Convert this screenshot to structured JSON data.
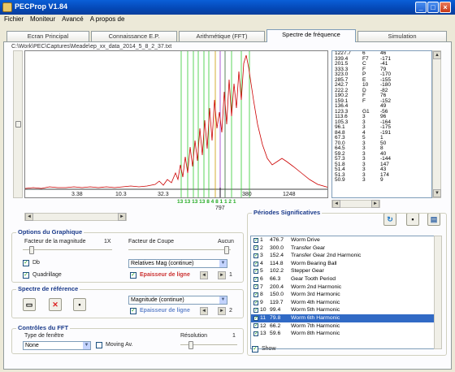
{
  "window": {
    "title": "PECProp V1.84"
  },
  "menu": [
    "Fichier",
    "Moniteur",
    "Avancé",
    "A propos de"
  ],
  "tabs": [
    {
      "label": "Ecran Principal"
    },
    {
      "label": "Connaissance E.P."
    },
    {
      "label": "Arithmétique (FFT)"
    },
    {
      "label": "Spectre de fréquence",
      "active": true
    },
    {
      "label": "Simulation"
    }
  ],
  "file_path": "C:\\Work\\PEC\\Captures\\Meade\\ep_xx_data_2014_5_8_2_37.txt",
  "plot": {
    "x_ticks": [
      "3.38",
      "10.3",
      "32.3",
      "380",
      "1248"
    ],
    "markers": [
      "13",
      "13 13",
      "13",
      "8",
      "4",
      "8",
      "1",
      "1",
      "2",
      "1"
    ],
    "cursor_label": "797"
  },
  "list_items": [
    [
      "1227.7",
      "6",
      "46"
    ],
    [
      "339.4",
      "F7",
      "-171"
    ],
    [
      "201.5",
      "C",
      "-41"
    ],
    [
      "333.3",
      "F",
      "79"
    ],
    [
      "323.0",
      "P",
      "-170"
    ],
    [
      "285.7",
      "E",
      "-155"
    ],
    [
      "242.7",
      "10",
      "-180"
    ],
    [
      "222.2",
      "D",
      "-82"
    ],
    [
      "190.2",
      "F",
      "76"
    ],
    [
      "159.1",
      "F",
      "-152"
    ],
    [
      "136.4",
      "",
      "49"
    ],
    [
      "123.3",
      "G1",
      "-56"
    ],
    [
      "113.6",
      "3",
      "96"
    ],
    [
      "105.3",
      "3",
      "-164"
    ],
    [
      "96.1",
      "3",
      "-175"
    ],
    [
      "84.8",
      "4",
      "-191"
    ],
    [
      "67.3",
      "5",
      "1"
    ],
    [
      "70.0",
      "3",
      "50"
    ],
    [
      "64.5",
      "3",
      "8"
    ],
    [
      "59.2",
      "3",
      "40"
    ],
    [
      "57.3",
      "3",
      "-144"
    ],
    [
      "51.8",
      "3",
      "147"
    ],
    [
      "51.4",
      "3",
      "43"
    ],
    [
      "51.3",
      "3",
      "174"
    ],
    [
      "50.9",
      "3",
      "9"
    ]
  ],
  "options_graph": {
    "legend": "Options du Graphique",
    "magnitude_label": "Facteur de la magnitude",
    "magnitude_value": "1X",
    "cut_label": "Facteur de Coupe",
    "cut_value": "Aucun",
    "chk_db": "Db",
    "chk_quadrillage": "Quadrillage",
    "combo_relative": "Relatives Mag (continue)",
    "epaisseur_label": "Epaisseur de ligne",
    "epaisseur_value": "1"
  },
  "spectre_ref": {
    "legend": "Spectre de référence",
    "combo_magnitude": "Magnitude (continue)",
    "epaisseur_label": "Epaisseur de ligne",
    "epaisseur_value": "2"
  },
  "fft_controls": {
    "legend": "Contrôles du FFT",
    "window_label": "Type de fenêtre",
    "window_value": "None",
    "moving_avg": "Moving Av.",
    "resolution_label": "Résolution",
    "resolution_value": "1"
  },
  "periods": {
    "legend": "Périodes Significatives",
    "rows": [
      [
        "1",
        "476.7",
        "Worm Drive"
      ],
      [
        "2",
        "300.0",
        "Transfer Gear"
      ],
      [
        "3",
        "152.4",
        "Transfer Gear 2nd Harmonic"
      ],
      [
        "4",
        "114.8",
        "Worm Bearing Ball"
      ],
      [
        "5",
        "102.2",
        "Stepper Gear"
      ],
      [
        "6",
        "66.3",
        "Gear Tooth Period"
      ],
      [
        "7",
        "200.4",
        "Worm 2nd Harmonic"
      ],
      [
        "8",
        "150.0",
        "Worm 3rd Harmonic"
      ],
      [
        "9",
        "119.7",
        "Worm 4th Harmonic"
      ],
      [
        "10",
        "99.4",
        "Worm 5th Harmonic"
      ],
      [
        "11",
        "79.8",
        "Worm 6th Harmonic"
      ],
      [
        "12",
        "66.2",
        "Worm 7th Harmonic"
      ],
      [
        "13",
        "59.6",
        "Worm 8th Harmonic"
      ]
    ],
    "footer_check": "Show"
  },
  "colors": {
    "accent": "#316ac5",
    "curve": "#cc0000",
    "marker_green": "#33cc33",
    "marker_dark": "#336633"
  }
}
